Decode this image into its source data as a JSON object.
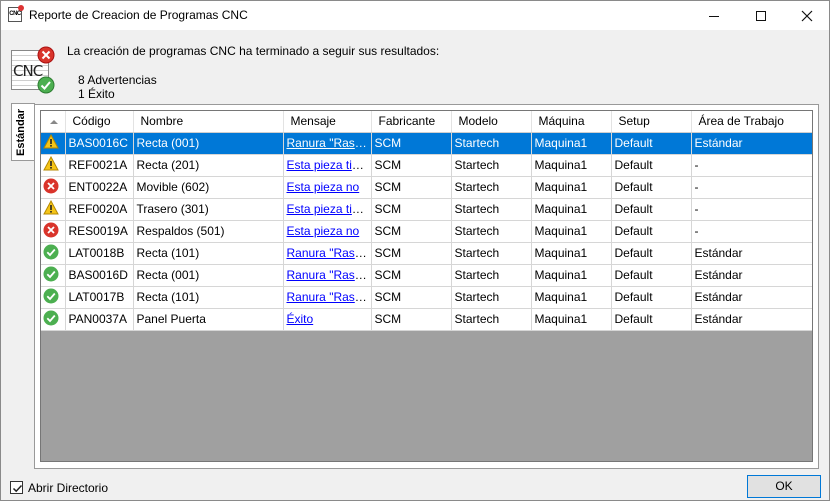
{
  "window": {
    "title": "Reporte de Creacion de Programas CNC",
    "app_icon_text": "CNC"
  },
  "header": {
    "icon_text": "CNC",
    "message": "La creación de programas CNC ha terminado a seguir sus resultados:",
    "warnings": "8 Advertencias",
    "success": "1 Éxito"
  },
  "side_tab": {
    "label": "Estándar"
  },
  "table": {
    "columns": [
      "",
      "Código",
      "Nombre",
      "Mensaje",
      "Fabricante",
      "Modelo",
      "Máquina",
      "Setup",
      "Área de Trabajo"
    ],
    "rows": [
      {
        "icon": "warning",
        "codigo": "BAS0016C",
        "nombre": "Recta (001)",
        "mensaje": "Ranura \"Rasqueta\"",
        "fabricante": "SCM",
        "modelo": "Startech",
        "maquina": "Maquina1",
        "setup": "Default",
        "area": "Estándar",
        "selected": true
      },
      {
        "icon": "warning",
        "codigo": "REF0021A",
        "nombre": "Recta (201)",
        "mensaje": "Esta pieza tiene",
        "fabricante": "SCM",
        "modelo": "Startech",
        "maquina": "Maquina1",
        "setup": "Default",
        "area": "-",
        "selected": false
      },
      {
        "icon": "error",
        "codigo": "ENT0022A",
        "nombre": "Movible (602)",
        "mensaje": "Esta pieza no",
        "fabricante": "SCM",
        "modelo": "Startech",
        "maquina": "Maquina1",
        "setup": "Default",
        "area": "-",
        "selected": false
      },
      {
        "icon": "warning",
        "codigo": "REF0020A",
        "nombre": "Trasero (301)",
        "mensaje": "Esta pieza tiene",
        "fabricante": "SCM",
        "modelo": "Startech",
        "maquina": "Maquina1",
        "setup": "Default",
        "area": "-",
        "selected": false
      },
      {
        "icon": "error",
        "codigo": "RES0019A",
        "nombre": "Respaldos (501)",
        "mensaje": "Esta pieza no",
        "fabricante": "SCM",
        "modelo": "Startech",
        "maquina": "Maquina1",
        "setup": "Default",
        "area": "-",
        "selected": false
      },
      {
        "icon": "ok",
        "codigo": "LAT0018B",
        "nombre": "Recta (101)",
        "mensaje": "Ranura \"Rasqueta\"",
        "fabricante": "SCM",
        "modelo": "Startech",
        "maquina": "Maquina1",
        "setup": "Default",
        "area": "Estándar",
        "selected": false
      },
      {
        "icon": "ok",
        "codigo": "BAS0016D",
        "nombre": "Recta (001)",
        "mensaje": "Ranura \"Rasqueta\"",
        "fabricante": "SCM",
        "modelo": "Startech",
        "maquina": "Maquina1",
        "setup": "Default",
        "area": "Estándar",
        "selected": false
      },
      {
        "icon": "ok",
        "codigo": "LAT0017B",
        "nombre": "Recta (101)",
        "mensaje": "Ranura \"Rasqueta\"",
        "fabricante": "SCM",
        "modelo": "Startech",
        "maquina": "Maquina1",
        "setup": "Default",
        "area": "Estándar",
        "selected": false
      },
      {
        "icon": "ok",
        "codigo": "PAN0037A",
        "nombre": "Panel Puerta",
        "mensaje": "Éxito",
        "fabricante": "SCM",
        "modelo": "Startech",
        "maquina": "Maquina1",
        "setup": "Default",
        "area": "Estándar",
        "selected": false
      }
    ]
  },
  "footer": {
    "checkbox_label": "Abrir Directorio",
    "checkbox_checked": true,
    "ok_label": "OK"
  },
  "colors": {
    "selection": "#0078d7",
    "link": "#0000ff",
    "warning": "#f5c518",
    "error": "#d9342b",
    "ok": "#4caf50"
  }
}
